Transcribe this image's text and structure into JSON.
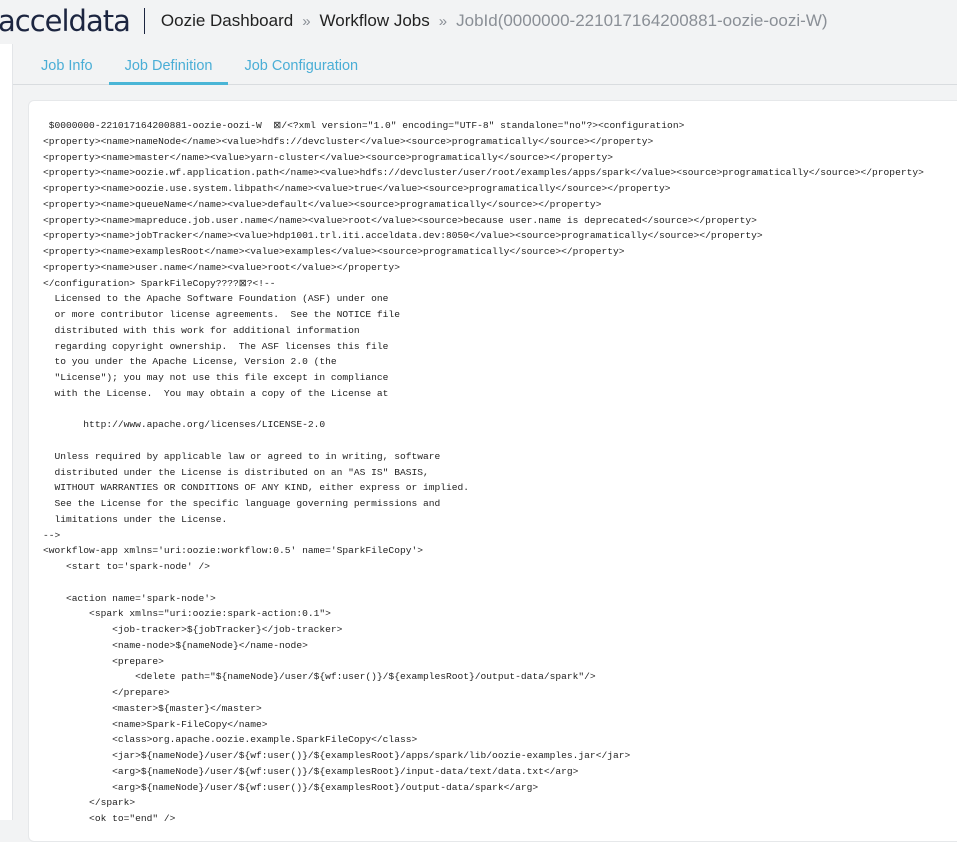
{
  "header": {
    "logo": "acceldata",
    "breadcrumb": [
      "Oozie Dashboard",
      "Workflow Jobs",
      "JobId(0000000-221017164200881-oozie-oozi-W)"
    ],
    "separator": "»"
  },
  "tabs": [
    {
      "label": "Job Info",
      "active": false
    },
    {
      "label": "Job Definition",
      "active": true
    },
    {
      "label": "Job Configuration",
      "active": false
    }
  ],
  "definition_lines": [
    " $0000000-221017164200881-oozie-oozi-W  ⊠/<?xml version=\"1.0\" encoding=\"UTF-8\" standalone=\"no\"?><configuration>",
    "<property><name>nameNode</name><value>hdfs://devcluster</value><source>programatically</source></property>",
    "<property><name>master</name><value>yarn-cluster</value><source>programatically</source></property>",
    "<property><name>oozie.wf.application.path</name><value>hdfs://devcluster/user/root/examples/apps/spark</value><source>programatically</source></property>",
    "<property><name>oozie.use.system.libpath</name><value>true</value><source>programatically</source></property>",
    "<property><name>queueName</name><value>default</value><source>programatically</source></property>",
    "<property><name>mapreduce.job.user.name</name><value>root</value><source>because user.name is deprecated</source></property>",
    "<property><name>jobTracker</name><value>hdp1001.trl.iti.acceldata.dev:8050</value><source>programatically</source></property>",
    "<property><name>examplesRoot</name><value>examples</value><source>programatically</source></property>",
    "<property><name>user.name</name><value>root</value></property>",
    "</configuration> SparkFileCopy????⊠?<!--",
    "  Licensed to the Apache Software Foundation (ASF) under one",
    "  or more contributor license agreements.  See the NOTICE file",
    "  distributed with this work for additional information",
    "  regarding copyright ownership.  The ASF licenses this file",
    "  to you under the Apache License, Version 2.0 (the",
    "  \"License\"); you may not use this file except in compliance",
    "  with the License.  You may obtain a copy of the License at",
    "",
    "       http://www.apache.org/licenses/LICENSE-2.0",
    "",
    "  Unless required by applicable law or agreed to in writing, software",
    "  distributed under the License is distributed on an \"AS IS\" BASIS,",
    "  WITHOUT WARRANTIES OR CONDITIONS OF ANY KIND, either express or implied.",
    "  See the License for the specific language governing permissions and",
    "  limitations under the License.",
    "-->",
    "<workflow-app xmlns='uri:oozie:workflow:0.5' name='SparkFileCopy'>",
    "    <start to='spark-node' />",
    "",
    "    <action name='spark-node'>",
    "        <spark xmlns=\"uri:oozie:spark-action:0.1\">",
    "            <job-tracker>${jobTracker}</job-tracker>",
    "            <name-node>${nameNode}</name-node>",
    "            <prepare>",
    "                <delete path=\"${nameNode}/user/${wf:user()}/${examplesRoot}/output-data/spark\"/>",
    "            </prepare>",
    "            <master>${master}</master>",
    "            <name>Spark-FileCopy</name>",
    "            <class>org.apache.oozie.example.SparkFileCopy</class>",
    "            <jar>${nameNode}/user/${wf:user()}/${examplesRoot}/apps/spark/lib/oozie-examples.jar</jar>",
    "            <arg>${nameNode}/user/${wf:user()}/${examplesRoot}/input-data/text/data.txt</arg>",
    "            <arg>${nameNode}/user/${wf:user()}/${examplesRoot}/output-data/spark</arg>",
    "        </spark>",
    "        <ok to=\"end\" />"
  ]
}
